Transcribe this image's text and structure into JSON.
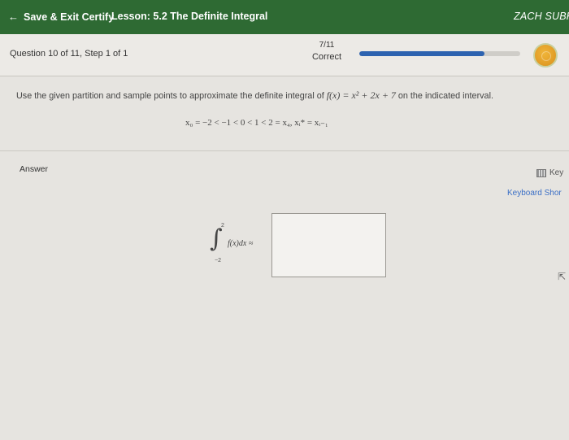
{
  "topbar": {
    "save_label": "Save & Exit Certify",
    "lesson_label": "Lesson: 5.2 The Definite Integral",
    "user_name": "ZACH SUBKE"
  },
  "question": {
    "title": "Question 10 of 11, Step 1 of 1",
    "score": "7/11",
    "status": "Correct",
    "progress_fraction": 0.78
  },
  "problem": {
    "text_before": "Use the given partition and sample points to approximate the definite integral of ",
    "function": "f(x) = x² + 2x + 7",
    "text_after": " on the indicated interval.",
    "partition": "x₀ = −2 < −1 < 0 < 1 < 2 = x₄,  xᵢ* = xᵢ₋₁"
  },
  "answer": {
    "label": "Answer",
    "keypad_label": "Key",
    "keyboard_shortcuts": "Keyboard Shor",
    "integral_upper": "2",
    "integral_lower": "−2",
    "integral_expr": "f(x)dx ≈",
    "input_value": ""
  },
  "colors": {
    "topbar": "#2e6a33",
    "progress": "#2d63b0",
    "link": "#3b6fc6"
  }
}
